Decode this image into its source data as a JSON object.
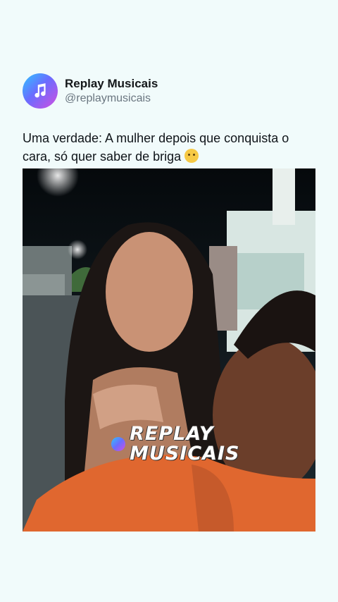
{
  "account": {
    "display_name": "Replay Musicais",
    "handle": "@replaymusicais",
    "avatar_icon": "music-note-icon"
  },
  "post": {
    "text": "Uma verdade: A mulher depois que conquista o cara, só quer saber de briga",
    "emoji": "crying-face-emoji"
  },
  "media": {
    "watermark_line1": "REPLAY",
    "watermark_line2": "MUSICAIS",
    "watermark_icon": "music-note-icon"
  },
  "colors": {
    "background": "#f1fbfb",
    "text": "#0f1419",
    "handle": "#6a7680"
  }
}
